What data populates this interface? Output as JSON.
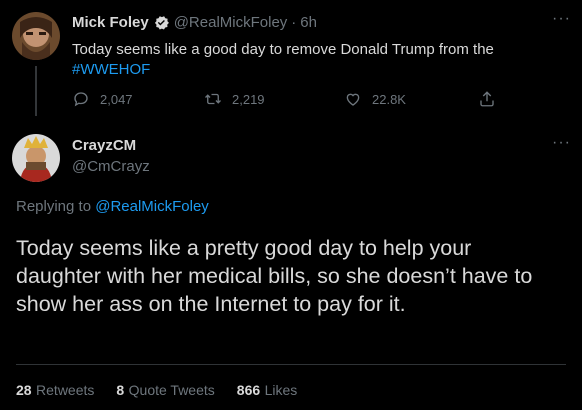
{
  "original_tweet": {
    "author_name": "Mick Foley",
    "handle": "@RealMickFoley",
    "separator": "·",
    "time": "6h",
    "text_line1": "Today seems like a good day to remove Donald Trump from the",
    "hashtag": "#WWEHOF",
    "replies": "2,047",
    "retweets": "2,219",
    "likes": "22.8K"
  },
  "reply_tweet": {
    "author_name": "CrayzCM",
    "handle": "@CmCrayz",
    "replying_prefix": "Replying to",
    "replying_to": "@RealMickFoley",
    "text_line1": "Today seems like a pretty good day to help your",
    "text_line2": "daughter with her medical bills, so she doesn’t have to",
    "text_line3": "show her ass on the Internet to pay for it."
  },
  "stats": {
    "retweets_count": "28",
    "retweets_label": "Retweets",
    "quote_count": "8",
    "quote_label": "Quote Tweets",
    "likes_count": "866",
    "likes_label": "Likes"
  },
  "more_label": "···",
  "colors": {
    "background": "#000000",
    "text": "#d9d9d9",
    "muted": "#6e767d",
    "link": "#1d9bf0",
    "verified": "#d9d9d9"
  },
  "icons": [
    "reply-icon",
    "retweet-icon",
    "like-icon",
    "share-icon",
    "verified-badge-icon",
    "more-icon"
  ]
}
